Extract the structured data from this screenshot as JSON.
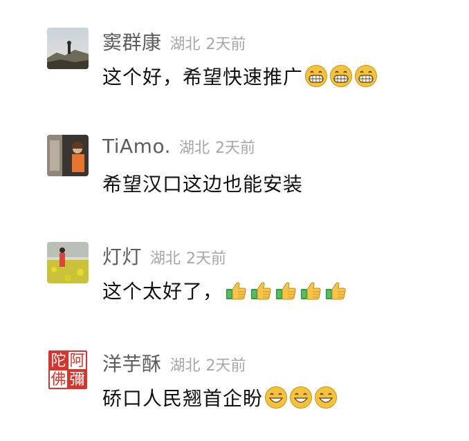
{
  "comments": [
    {
      "username": "窦群康",
      "location": "湖北",
      "time": "2天前",
      "text": "这个好，希望快速推广",
      "emoji": "grin-face-icon",
      "emoji_count": 3
    },
    {
      "username": "TiAmo.",
      "location": "湖北",
      "time": "2天前",
      "text": "希望汉口这边也能安装",
      "emoji": "",
      "emoji_count": 0
    },
    {
      "username": "灯灯",
      "location": "湖北",
      "time": "2天前",
      "text": "这个太好了，",
      "emoji": "thumbs-up-icon",
      "emoji_count": 5
    },
    {
      "username": "洋芋酥",
      "location": "湖北",
      "time": "2天前",
      "text": "硚口人民翘首企盼",
      "emoji": "smiling-face-icon",
      "emoji_count": 3
    }
  ],
  "avatars": {
    "seal_text": [
      "陀",
      "阿",
      "佛",
      "彌"
    ]
  },
  "colors": {
    "username": "#5c5c5c",
    "meta": "#a6a6a6",
    "text": "#111111",
    "seal_red": "#d9342b",
    "emoji_yellow": "#f5c33b"
  }
}
